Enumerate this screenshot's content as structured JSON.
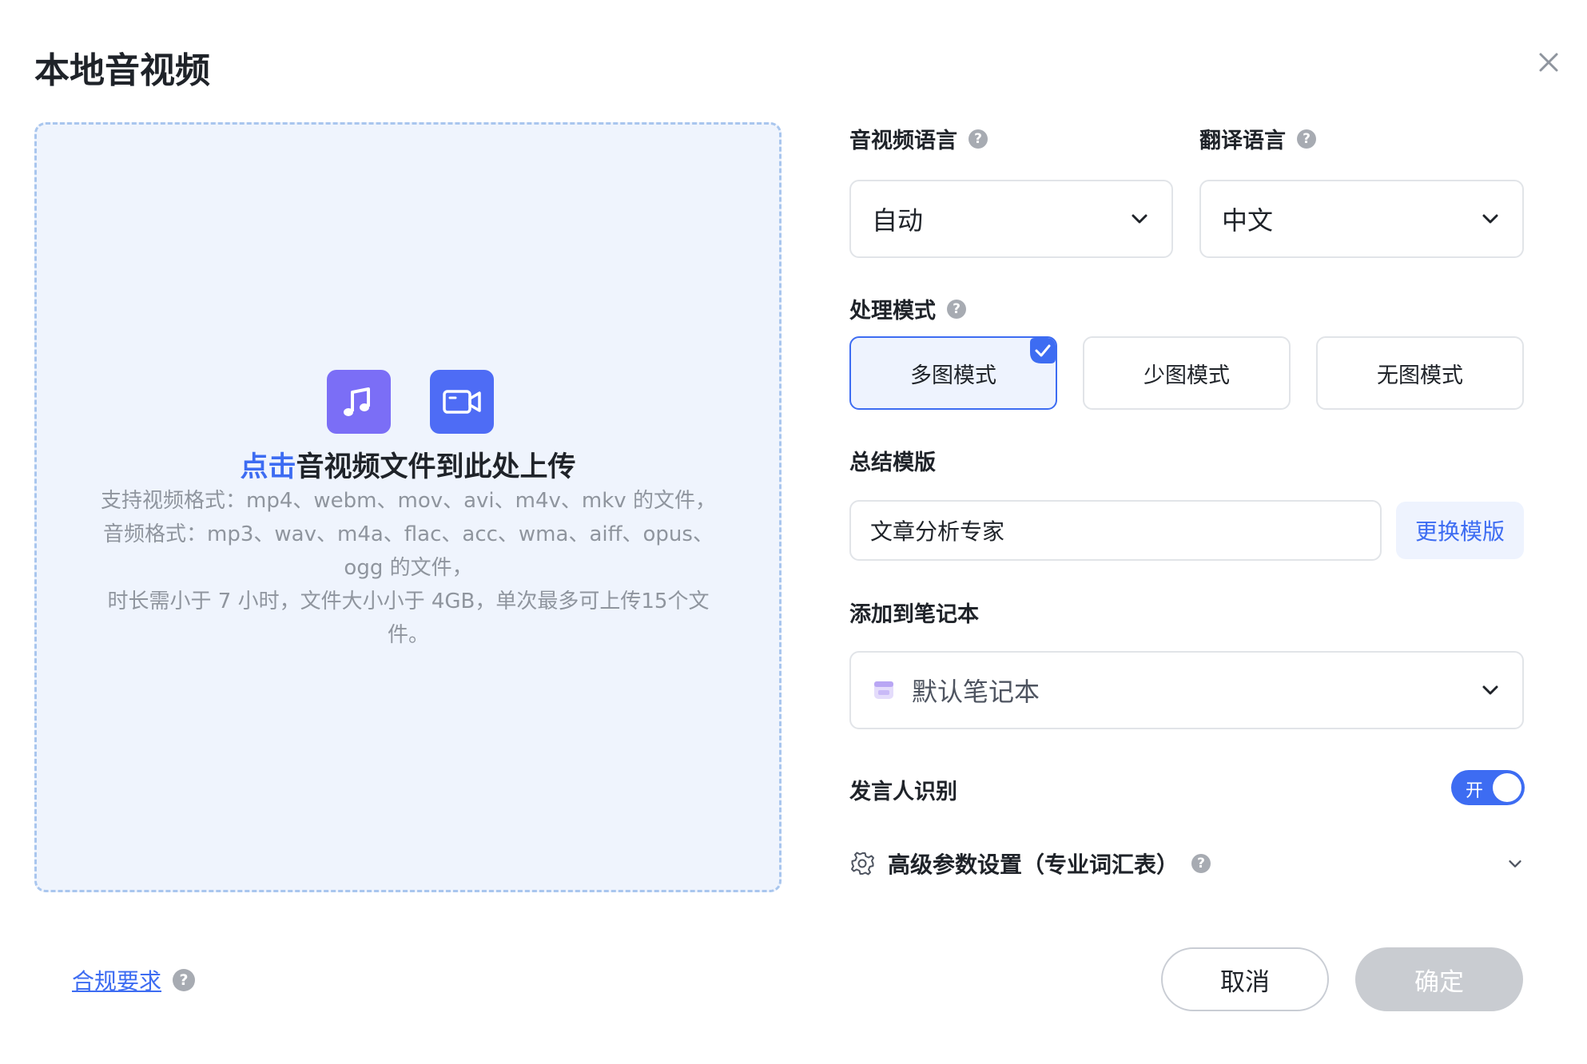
{
  "dialog": {
    "title": "本地音视频"
  },
  "upload": {
    "cta_link": "点击",
    "cta_text": "音视频文件到此处上传",
    "info_lines": [
      "支持视频格式：mp4、webm、mov、avi、m4v、mkv 的文件，",
      "音频格式：mp3、wav、m4a、flac、acc、wma、aiff、opus、",
      "ogg 的文件，",
      "时长需小于 7 小时，文件大小小于 4GB，单次最多可上传15个文",
      "件。"
    ]
  },
  "form": {
    "media_language": {
      "label": "音视频语言",
      "value": "自动"
    },
    "translate_language": {
      "label": "翻译语言",
      "value": "中文"
    },
    "processing_mode": {
      "label": "处理模式",
      "options": [
        "多图模式",
        "少图模式",
        "无图模式"
      ],
      "selected": "多图模式"
    },
    "summary_template": {
      "label": "总结模版",
      "value": "文章分析专家",
      "change_label": "更换模版"
    },
    "notebook": {
      "label": "添加到笔记本",
      "value": "默认笔记本"
    },
    "speaker_recognition": {
      "label": "发言人识别",
      "toggle_text": "开",
      "on": true
    },
    "advanced": {
      "label": "高级参数设置（专业词汇表）"
    }
  },
  "footer": {
    "compliance": "合规要求",
    "cancel": "取消",
    "confirm": "确定"
  },
  "colors": {
    "accent": "#3d6cf2",
    "disabled": "#c9ccd1",
    "audio_icon": "#7b6ef6",
    "video_icon": "#4e6cf5"
  },
  "icons": [
    "close-icon",
    "music-note-icon",
    "video-camera-icon",
    "help-icon",
    "chevron-down-icon",
    "check-icon",
    "notebook-icon",
    "gear-icon"
  ]
}
